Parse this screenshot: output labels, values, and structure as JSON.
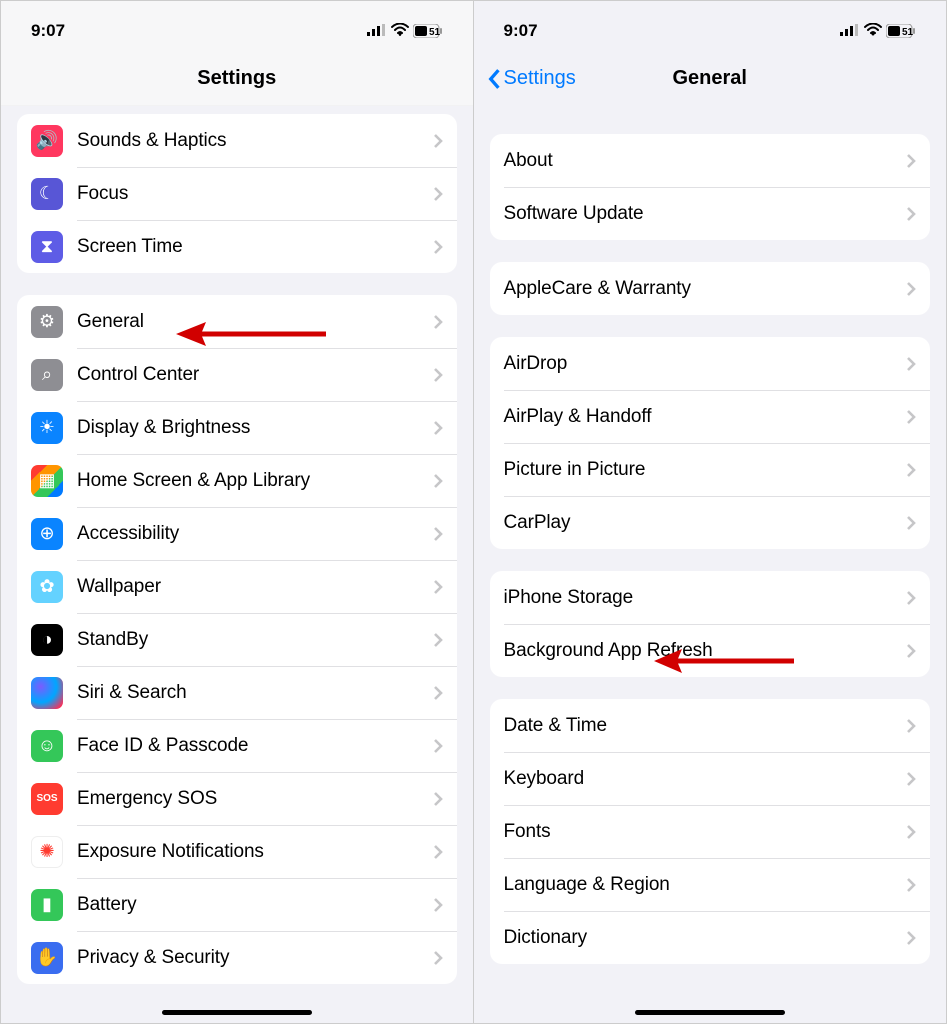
{
  "left": {
    "time": "9:07",
    "battery": "51",
    "title": "Settings",
    "groups": [
      {
        "rows": [
          {
            "label": "Sounds & Haptics",
            "icon": "sounds-icon",
            "color": "c-pink",
            "glyph": "🔊"
          },
          {
            "label": "Focus",
            "icon": "focus-icon",
            "color": "c-indigo",
            "glyph": "☾"
          },
          {
            "label": "Screen Time",
            "icon": "screentime-icon",
            "color": "c-purple",
            "glyph": "⧗"
          }
        ]
      },
      {
        "rows": [
          {
            "label": "General",
            "icon": "general-icon",
            "color": "c-gray",
            "glyph": "⚙"
          },
          {
            "label": "Control Center",
            "icon": "controlcenter-icon",
            "color": "c-gray2",
            "glyph": "⌕"
          },
          {
            "label": "Display & Brightness",
            "icon": "display-icon",
            "color": "c-blue",
            "glyph": "☀"
          },
          {
            "label": "Home Screen & App Library",
            "icon": "homescreen-icon",
            "color": "c-multi",
            "glyph": "▦"
          },
          {
            "label": "Accessibility",
            "icon": "accessibility-icon",
            "color": "c-acc",
            "glyph": "⊕"
          },
          {
            "label": "Wallpaper",
            "icon": "wallpaper-icon",
            "color": "c-cyan",
            "glyph": "✿"
          },
          {
            "label": "StandBy",
            "icon": "standby-icon",
            "color": "c-black",
            "glyph": "◑"
          },
          {
            "label": "Siri & Search",
            "icon": "siri-icon",
            "color": "c-siri",
            "glyph": ""
          },
          {
            "label": "Face ID & Passcode",
            "icon": "faceid-icon",
            "color": "c-green",
            "glyph": "☺"
          },
          {
            "label": "Emergency SOS",
            "icon": "sos-icon",
            "color": "c-red",
            "glyph": "SOS"
          },
          {
            "label": "Exposure Notifications",
            "icon": "exposure-icon",
            "color": "c-white",
            "glyph": "✺"
          },
          {
            "label": "Battery",
            "icon": "battery-icon",
            "color": "c-green",
            "glyph": "▮"
          },
          {
            "label": "Privacy & Security",
            "icon": "privacy-icon",
            "color": "c-hand",
            "glyph": "✋"
          }
        ]
      }
    ]
  },
  "right": {
    "time": "9:07",
    "battery": "51",
    "title": "General",
    "back": "Settings",
    "groups": [
      {
        "rows": [
          {
            "label": "About"
          },
          {
            "label": "Software Update"
          }
        ]
      },
      {
        "rows": [
          {
            "label": "AppleCare & Warranty"
          }
        ]
      },
      {
        "rows": [
          {
            "label": "AirDrop"
          },
          {
            "label": "AirPlay & Handoff"
          },
          {
            "label": "Picture in Picture"
          },
          {
            "label": "CarPlay"
          }
        ]
      },
      {
        "rows": [
          {
            "label": "iPhone Storage"
          },
          {
            "label": "Background App Refresh"
          }
        ]
      },
      {
        "rows": [
          {
            "label": "Date & Time"
          },
          {
            "label": "Keyboard"
          },
          {
            "label": "Fonts"
          },
          {
            "label": "Language & Region"
          },
          {
            "label": "Dictionary"
          }
        ]
      }
    ]
  }
}
